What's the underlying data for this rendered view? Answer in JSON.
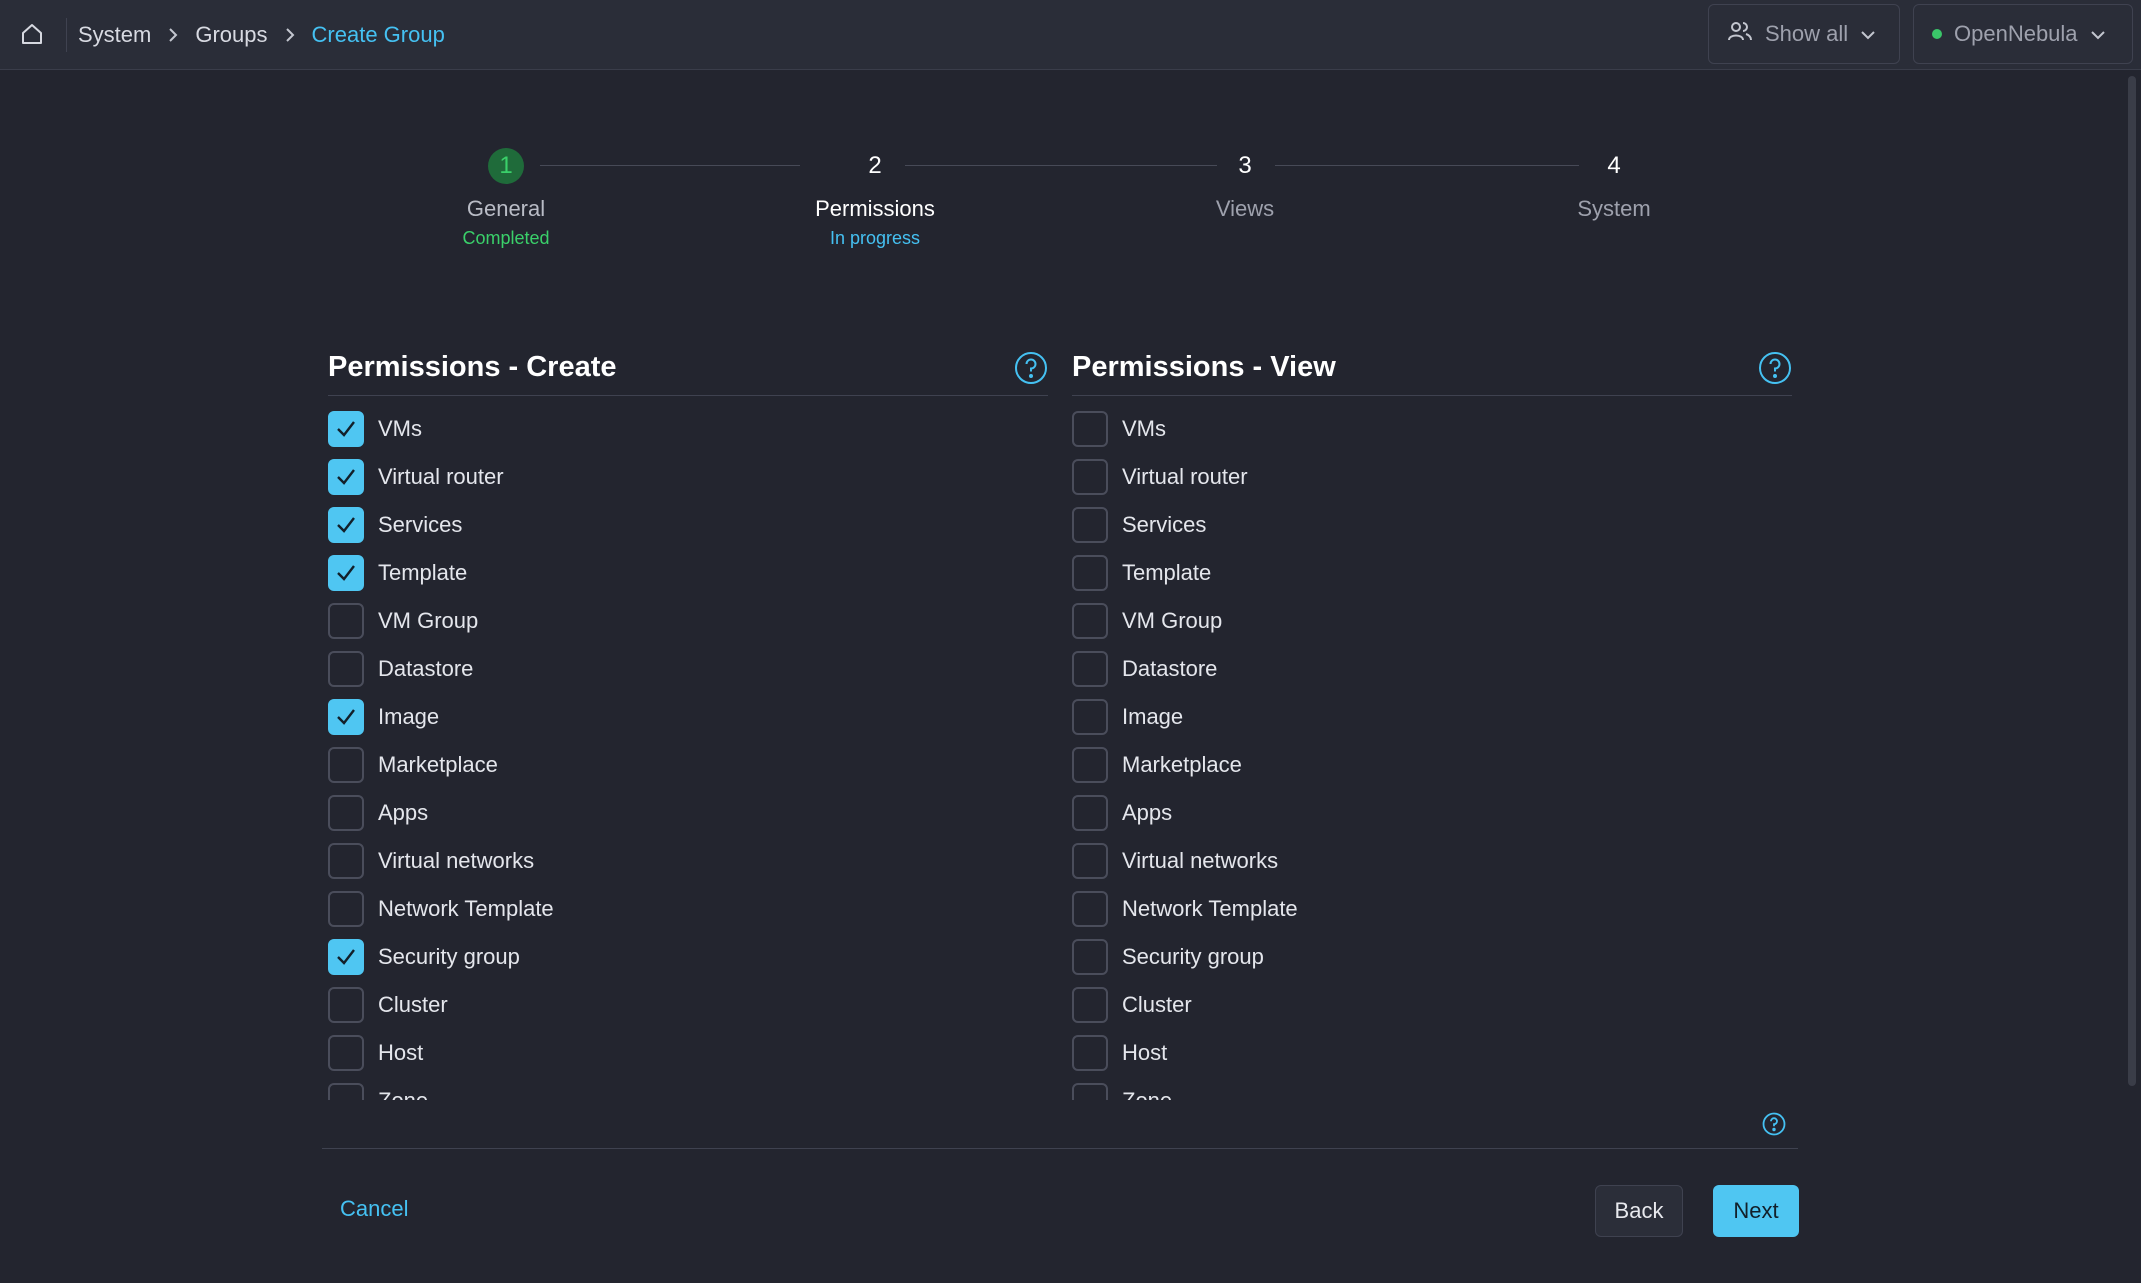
{
  "breadcrumb": {
    "items": [
      "System",
      "Groups"
    ],
    "current": "Create Group"
  },
  "header": {
    "show_all_label": "Show all",
    "zone_label": "OpenNebula",
    "zone_status_color": "#3ac569"
  },
  "stepper": {
    "steps": [
      {
        "number": "1",
        "label": "General",
        "status": "Completed",
        "state": "completed"
      },
      {
        "number": "2",
        "label": "Permissions",
        "status": "In progress",
        "state": "active"
      },
      {
        "number": "3",
        "label": "Views",
        "status": "",
        "state": "pending"
      },
      {
        "number": "4",
        "label": "System",
        "status": "",
        "state": "pending"
      }
    ]
  },
  "permissions_create": {
    "title": "Permissions - Create",
    "items": [
      {
        "label": "VMs",
        "checked": true
      },
      {
        "label": "Virtual router",
        "checked": true
      },
      {
        "label": "Services",
        "checked": true
      },
      {
        "label": "Template",
        "checked": true
      },
      {
        "label": "VM Group",
        "checked": false
      },
      {
        "label": "Datastore",
        "checked": false
      },
      {
        "label": "Image",
        "checked": true
      },
      {
        "label": "Marketplace",
        "checked": false
      },
      {
        "label": "Apps",
        "checked": false
      },
      {
        "label": "Virtual networks",
        "checked": false
      },
      {
        "label": "Network Template",
        "checked": false
      },
      {
        "label": "Security group",
        "checked": true
      },
      {
        "label": "Cluster",
        "checked": false
      },
      {
        "label": "Host",
        "checked": false
      },
      {
        "label": "Zone",
        "checked": false
      }
    ]
  },
  "permissions_view": {
    "title": "Permissions - View",
    "items": [
      {
        "label": "VMs",
        "checked": false
      },
      {
        "label": "Virtual router",
        "checked": false
      },
      {
        "label": "Services",
        "checked": false
      },
      {
        "label": "Template",
        "checked": false
      },
      {
        "label": "VM Group",
        "checked": false
      },
      {
        "label": "Datastore",
        "checked": false
      },
      {
        "label": "Image",
        "checked": false
      },
      {
        "label": "Marketplace",
        "checked": false
      },
      {
        "label": "Apps",
        "checked": false
      },
      {
        "label": "Virtual networks",
        "checked": false
      },
      {
        "label": "Network Template",
        "checked": false
      },
      {
        "label": "Security group",
        "checked": false
      },
      {
        "label": "Cluster",
        "checked": false
      },
      {
        "label": "Host",
        "checked": false
      },
      {
        "label": "Zone",
        "checked": false
      }
    ]
  },
  "footer": {
    "cancel_label": "Cancel",
    "back_label": "Back",
    "next_label": "Next"
  },
  "colors": {
    "accent": "#4fc6f2",
    "success": "#3ad06a",
    "background": "#23252f"
  },
  "icons": [
    "home-icon",
    "chevron-right-icon",
    "users-icon",
    "chevron-down-icon",
    "help-circle-icon",
    "checkmark-icon"
  ]
}
